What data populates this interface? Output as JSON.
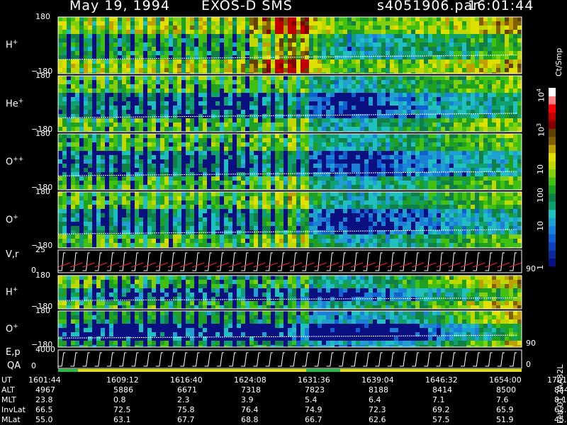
{
  "header": {
    "date": "May 19, 1994",
    "instrument": "EXOS-D SMS",
    "file": "s4051906.par",
    "time": "16:01:44"
  },
  "colorbar": {
    "label": "Ct/Smp",
    "ticks": [
      "10",
      "10",
      "10",
      "100",
      "10",
      "1"
    ],
    "exps": [
      "4",
      "3"
    ],
    "colors": [
      "#0a1080",
      "#0c2a9c",
      "#1040b8",
      "#1060d0",
      "#1a80d8",
      "#20a0d0",
      "#20c0c0",
      "#10a070",
      "#108048",
      "#20a020",
      "#40c010",
      "#80d010",
      "#c0d800",
      "#e0e000",
      "#c0a000",
      "#806000",
      "#604000",
      "#800000",
      "#c00000",
      "#ff0000",
      "#ff8080",
      "#ffffff"
    ]
  },
  "panels": [
    {
      "id": "h-plus",
      "label": "H",
      "sup": "+",
      "kind": "angle",
      "ytop": "180",
      "ybot": "−180"
    },
    {
      "id": "he-plus",
      "label": "He",
      "sup": "+",
      "kind": "angle",
      "ytop": "180",
      "ybot": "−180"
    },
    {
      "id": "o-plusplus",
      "label": "O",
      "sup": "++",
      "kind": "angle",
      "ytop": "180",
      "ybot": "−180"
    },
    {
      "id": "o-plus",
      "label": "O",
      "sup": "+",
      "kind": "angle",
      "ytop": "180",
      "ybot": "−180"
    },
    {
      "id": "vr",
      "label": "V,r",
      "sup": "",
      "kind": "line",
      "ytop": "25",
      "ybot": "0",
      "right": "90"
    },
    {
      "id": "h-plus-2",
      "label": "H",
      "sup": "+",
      "kind": "angle",
      "ytop": "180",
      "ybot": "−180"
    },
    {
      "id": "o-plus-2",
      "label": "O",
      "sup": "+",
      "kind": "angle",
      "ytop": "180",
      "ybot": "−180",
      "right": "90"
    },
    {
      "id": "ep",
      "label": "E,p",
      "sup": "",
      "kind": "line",
      "ytop": "4000",
      "ybot": "0",
      "right": "0"
    }
  ],
  "qa_label": "QA",
  "side_label": "Feb-01 2AA32L",
  "footer": {
    "rows": [
      {
        "name": "UT",
        "values": [
          "1601:44",
          "1609:12",
          "1616:40",
          "1624:08",
          "1631:36",
          "1639:04",
          "1646:32",
          "1654:00",
          "1701:28"
        ]
      },
      {
        "name": "ALT",
        "values": [
          "4967",
          "5886",
          "6671",
          "7318",
          "7823",
          "8188",
          "8414",
          "8500",
          "8449"
        ]
      },
      {
        "name": "MLT",
        "values": [
          "23.8",
          "0.8",
          "2.3",
          "3.9",
          "5.4",
          "6.4",
          "7.1",
          "7.6",
          "8.1"
        ]
      },
      {
        "name": "InvLat",
        "values": [
          "66.5",
          "72.5",
          "75.8",
          "76.4",
          "74.9",
          "72.3",
          "69.2",
          "65.9",
          "62.5"
        ]
      },
      {
        "name": "MLat",
        "values": [
          "55.0",
          "63.1",
          "67.7",
          "68.8",
          "66.7",
          "62.6",
          "57.5",
          "51.9",
          "45.8"
        ]
      }
    ]
  },
  "chart_data": [
    {
      "type": "heatmap",
      "title": "H+",
      "xlabel": "UT",
      "ylabel": "pitch angle",
      "ylim": [
        -180,
        180
      ],
      "x": [
        "1601:44",
        "1609:12",
        "1616:40",
        "1624:08",
        "1631:36",
        "1639:04",
        "1646:32",
        "1654:00",
        "1701:28"
      ],
      "intensity_by_time": [
        0.35,
        0.4,
        0.45,
        0.4,
        0.9,
        0.45,
        0.55,
        0.65,
        0.85
      ],
      "colorscale": "log counts per sample 1–10^4"
    },
    {
      "type": "heatmap",
      "title": "He+",
      "xlabel": "UT",
      "ylim": [
        -180,
        180
      ],
      "intensity_by_time": [
        0.25,
        0.25,
        0.25,
        0.2,
        0.3,
        0.2,
        0.35,
        0.5,
        0.6
      ]
    },
    {
      "type": "heatmap",
      "title": "O++",
      "xlabel": "UT",
      "ylim": [
        -180,
        180
      ],
      "intensity_by_time": [
        0.2,
        0.25,
        0.25,
        0.2,
        0.35,
        0.2,
        0.3,
        0.45,
        0.55
      ]
    },
    {
      "type": "heatmap",
      "title": "O+",
      "xlabel": "UT",
      "ylim": [
        -180,
        180
      ],
      "intensity_by_time": [
        0.25,
        0.25,
        0.3,
        0.2,
        0.45,
        0.2,
        0.3,
        0.45,
        0.55
      ]
    },
    {
      "type": "line",
      "title": "V,r",
      "ylim": [
        0,
        25
      ],
      "right_axis_max": 90,
      "sweeps": 38,
      "series_colors": [
        "#ffffff",
        "#ff2020"
      ]
    },
    {
      "type": "heatmap",
      "title": "H+",
      "xlabel": "UT",
      "ylim": [
        -180,
        180
      ],
      "intensity_by_time": [
        0.35,
        0.2,
        0.2,
        0.15,
        0.2,
        0.25,
        0.4,
        0.6,
        0.85
      ]
    },
    {
      "type": "heatmap",
      "title": "O+",
      "xlabel": "UT",
      "ylim": [
        -180,
        180
      ],
      "intensity_by_time": [
        0.15,
        0.1,
        0.1,
        0.1,
        0.1,
        0.1,
        0.2,
        0.45,
        0.8
      ]
    },
    {
      "type": "line",
      "title": "E,p",
      "ylim": [
        0,
        4000
      ],
      "sweeps": 38,
      "series_colors": [
        "#ffffff"
      ]
    }
  ]
}
